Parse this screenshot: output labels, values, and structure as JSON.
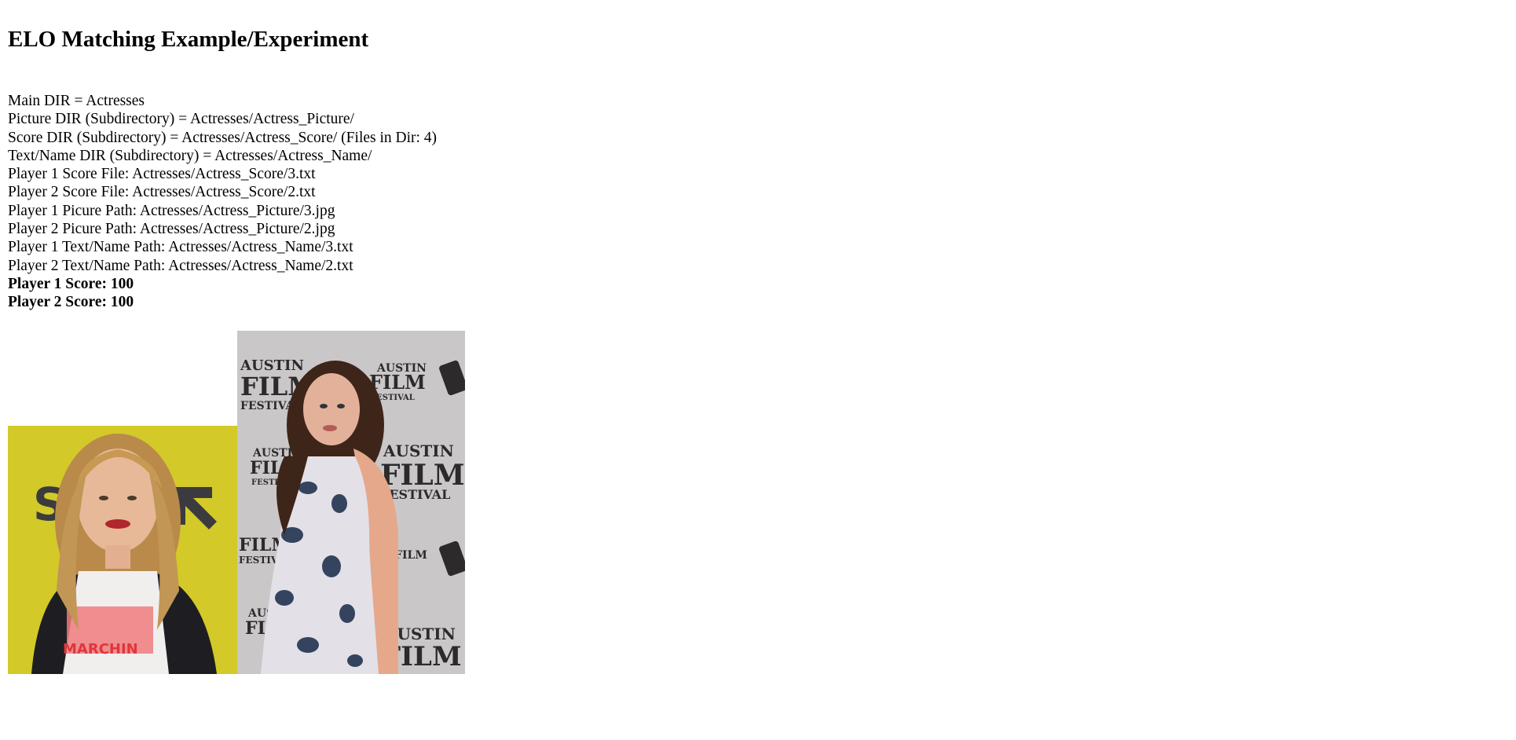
{
  "title": "ELO Matching Example/Experiment",
  "info": {
    "main_dir": "Main DIR = Actresses",
    "picture_dir": "Picture DIR (Subdirectory) = Actresses/Actress_Picture/",
    "score_dir": "Score DIR (Subdirectory) = Actresses/Actress_Score/ (Files in Dir: 4)",
    "name_dir": "Text/Name DIR (Subdirectory) = Actresses/Actress_Name/",
    "p1_score_file": "Player 1 Score File: Actresses/Actress_Score/3.txt",
    "p2_score_file": "Player 2 Score File: Actresses/Actress_Score/2.txt",
    "p1_picture_path": "Player 1 Picure Path: Actresses/Actress_Picture/3.jpg",
    "p2_picture_path": "Player 2 Picure Path: Actresses/Actress_Picture/2.jpg",
    "p1_name_path": "Player 1 Text/Name Path: Actresses/Actress_Name/3.txt",
    "p2_name_path": "Player 2 Text/Name Path: Actresses/Actress_Name/2.txt",
    "p1_score": "Player 1 Score: 100",
    "p2_score": "Player 2 Score: 100"
  },
  "photo1": {
    "backdrop_text_left": "SX",
    "shirt_text": "MARCHIN"
  },
  "photo2": {
    "backdrop_line1": "AUSTIN",
    "backdrop_line2": "FILM",
    "backdrop_line3": "FESTIVAL"
  },
  "colors": {
    "photo1_backdrop": "#d6cc2a",
    "photo2_backdrop": "#c9c7c8",
    "photo2_text": "#2c2a2b"
  }
}
